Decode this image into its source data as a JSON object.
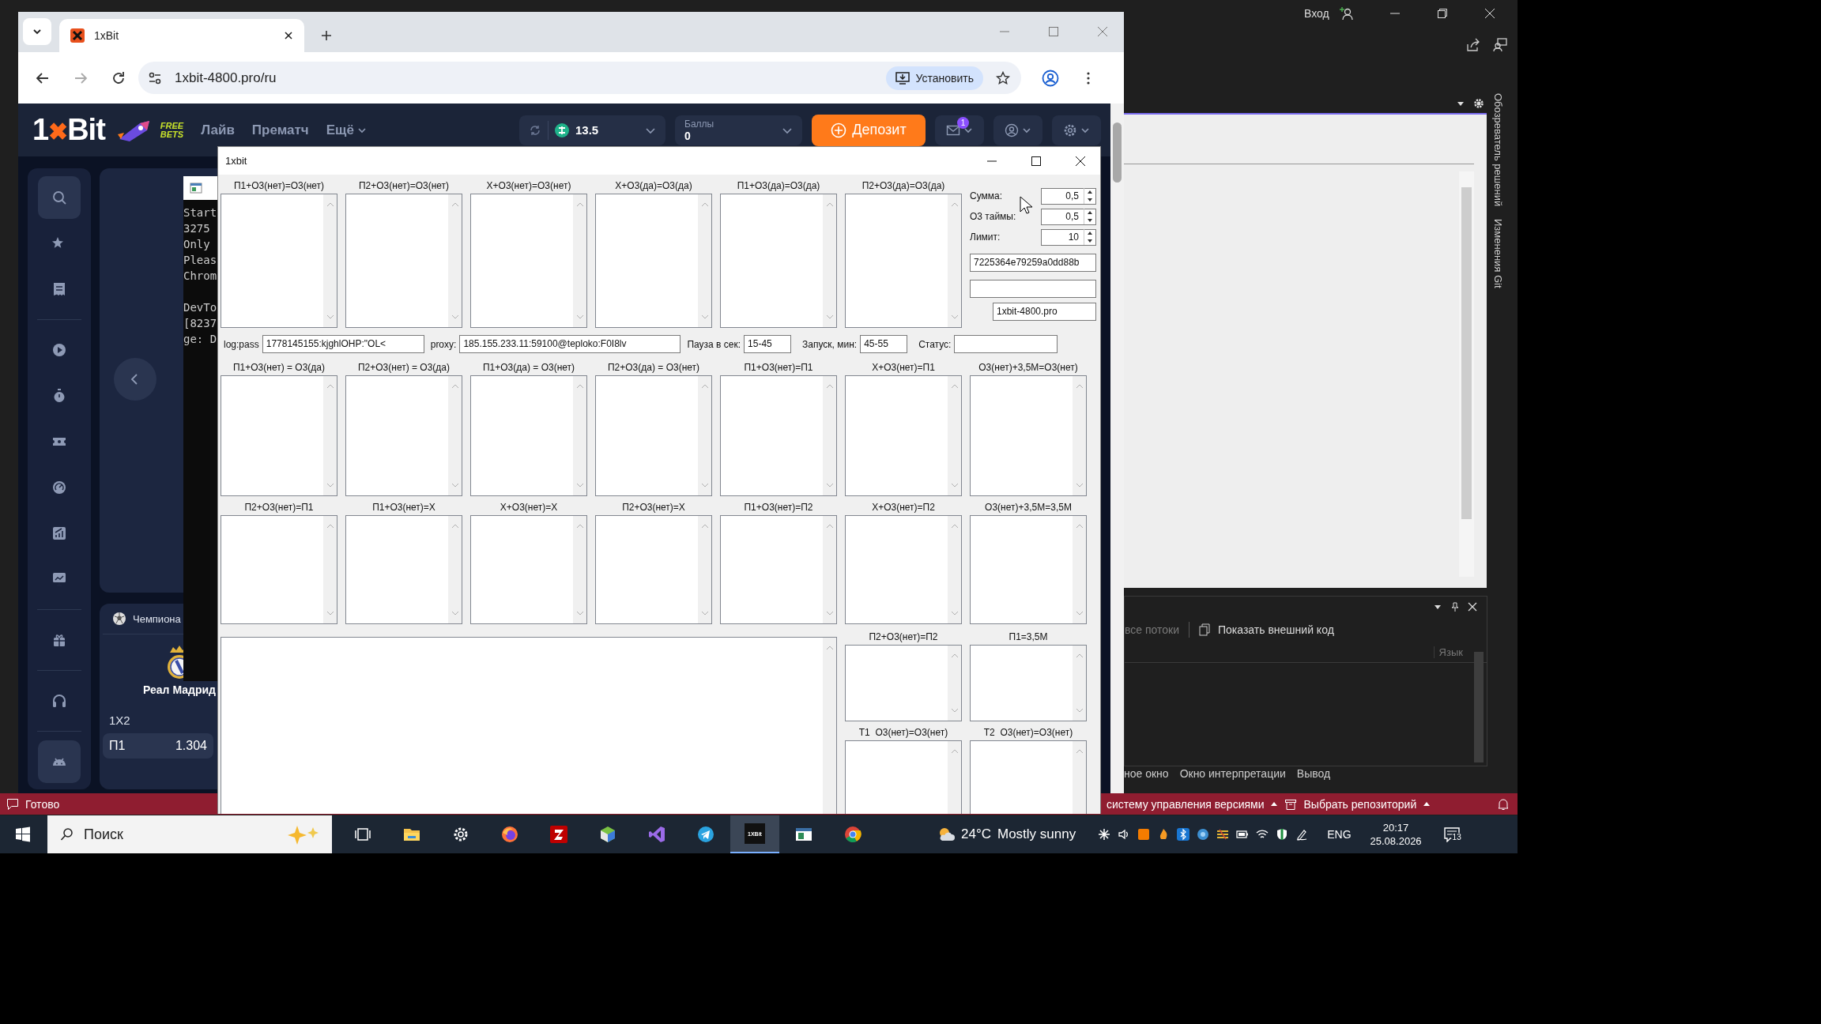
{
  "ide": {
    "sign_in": "Вход",
    "side_tabs": [
      "Обозреватель решений",
      "Изменения Git"
    ],
    "debug_toolbar": [
      {
        "label": "все потоки",
        "disabled": true
      },
      {
        "label": "Показать внешний код",
        "disabled": false
      }
    ],
    "column_header": "Язык",
    "bottom_tabs": [
      "ное окно",
      "Окно интерпретации",
      "Вывод"
    ],
    "status_bar": {
      "state": "Готово",
      "items": [
        "систему управления версиями",
        "Выбрать репозиторий"
      ]
    }
  },
  "browser": {
    "tab_title": "1xBit",
    "url": "1xbit-4800.pro/ru",
    "install_button": "Установить"
  },
  "site": {
    "logo": [
      {
        "text": "1",
        "accent": false
      },
      {
        "text": "✖",
        "accent": true
      },
      {
        "text": "Bit",
        "accent": false
      }
    ],
    "promo": [
      "FREE",
      "BETS"
    ],
    "nav": [
      {
        "label": "Лайв",
        "dropdown": false
      },
      {
        "label": "Прематч",
        "dropdown": false
      },
      {
        "label": "Ещё",
        "dropdown": true
      }
    ],
    "balance": "13.5",
    "points": {
      "label": "Баллы",
      "value": "0"
    },
    "deposit_button": "Депозит",
    "mail_badge": "1",
    "match": {
      "league": "Чемпиона",
      "team": "Реал Мадрид",
      "market": "1X2",
      "odds": [
        {
          "label": "П1",
          "value": "1.304"
        }
      ]
    }
  },
  "console": {
    "blocks": [
      [
        "Start",
        "3275",
        "Only",
        "Pleas",
        "Chrom"
      ],
      [
        "DevTo",
        "[8237",
        "ge: D"
      ]
    ]
  },
  "form": {
    "title": "1xbit",
    "top_lists": [
      "П1+О3(нет)=О3(нет)",
      "П2+О3(нет)=О3(нет)",
      "Х+О3(нет)=О3(нет)",
      "Х+О3(да)=О3(да)",
      "П1+О3(да)=О3(да)",
      "П2+О3(да)=О3(да)"
    ],
    "settings": [
      {
        "label": "Сумма:",
        "value": "0,5"
      },
      {
        "label": "О3 таймы:",
        "value": "0,5"
      },
      {
        "label": "Лимит:",
        "value": "10"
      }
    ],
    "token": "7225364e79259a0dd88b",
    "domain": "1xbit-4800.pro",
    "credentials": [
      {
        "label": "log:pass",
        "value": "1778145155:kjghlOHP:\"OL<",
        "kind": "login"
      },
      {
        "label": "proxy:",
        "value": "185.155.233.11:59100@teploko:F0I8lv",
        "kind": "proxy"
      },
      {
        "label": "Пауза в сек:",
        "value": "15-45",
        "kind": "short"
      },
      {
        "label": "Запуск, мин:",
        "value": "45-55",
        "kind": "short"
      },
      {
        "label": "Статус:",
        "kind": "status"
      }
    ],
    "middle_lists": [
      "П1+О3(нет) = О3(да)",
      "П2+О3(нет) = О3(да)",
      "П1+О3(да) = О3(нет)",
      "П2+О3(да) = О3(нет)",
      "П1+О3(нет)=П1",
      "Х+О3(нет)=П1",
      "О3(нет)+3,5М=О3(нет)"
    ],
    "lower_lists": [
      "П2+О3(нет)=П1",
      "П1+О3(нет)=Х",
      "Х+О3(нет)=Х",
      "П2+О3(нет)=Х",
      "П1+О3(нет)=П2",
      "Х+О3(нет)=П2",
      "О3(нет)+3,5М=3,5М"
    ],
    "bottom_lists": [
      [
        "П2+О3(нет)=П2",
        "Т1  О3(нет)=О3(нет)"
      ],
      [
        "П1=3,5М",
        "Т2  О3(нет)=О3(нет)"
      ]
    ]
  },
  "taskbar": {
    "search_placeholder": "Поиск",
    "apps": [
      {
        "kind": "taskview",
        "selected": false
      },
      {
        "kind": "explorer",
        "selected": false
      },
      {
        "kind": "settings",
        "selected": false
      },
      {
        "kind": "firefox",
        "selected": false
      },
      {
        "kind": "filezilla",
        "selected": false
      },
      {
        "kind": "cube",
        "selected": false
      },
      {
        "kind": "studio",
        "selected": false
      },
      {
        "kind": "telegram",
        "selected": false
      },
      {
        "kind": "tile",
        "selected": true,
        "label": "1XBit"
      },
      {
        "kind": "window",
        "selected": false
      },
      {
        "kind": "chrome",
        "selected": false
      }
    ],
    "weather": {
      "temp": "24°C",
      "text": "Mostly sunny"
    },
    "language": "ENG",
    "time": "20:17",
    "date": "25.08.2026",
    "notifications": "13"
  }
}
